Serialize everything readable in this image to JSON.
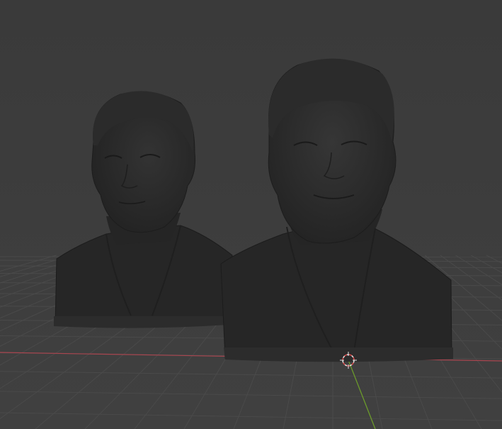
{
  "viewport": {
    "mode": "3d-viewport",
    "shading": "solid",
    "background_color": "#3d3d3d",
    "grid_color": "#4a4a4a",
    "x_axis_color": "#a8454f",
    "y_axis_color": "#6b9a2b",
    "cursor_color": "#d04a4a"
  },
  "objects": [
    {
      "id": "bust-left",
      "type": "bust-mesh",
      "color": "#2a2a2a"
    },
    {
      "id": "bust-right",
      "type": "bust-mesh",
      "color": "#2a2a2a"
    }
  ],
  "cursor": {
    "icon": "3d-cursor-icon"
  }
}
